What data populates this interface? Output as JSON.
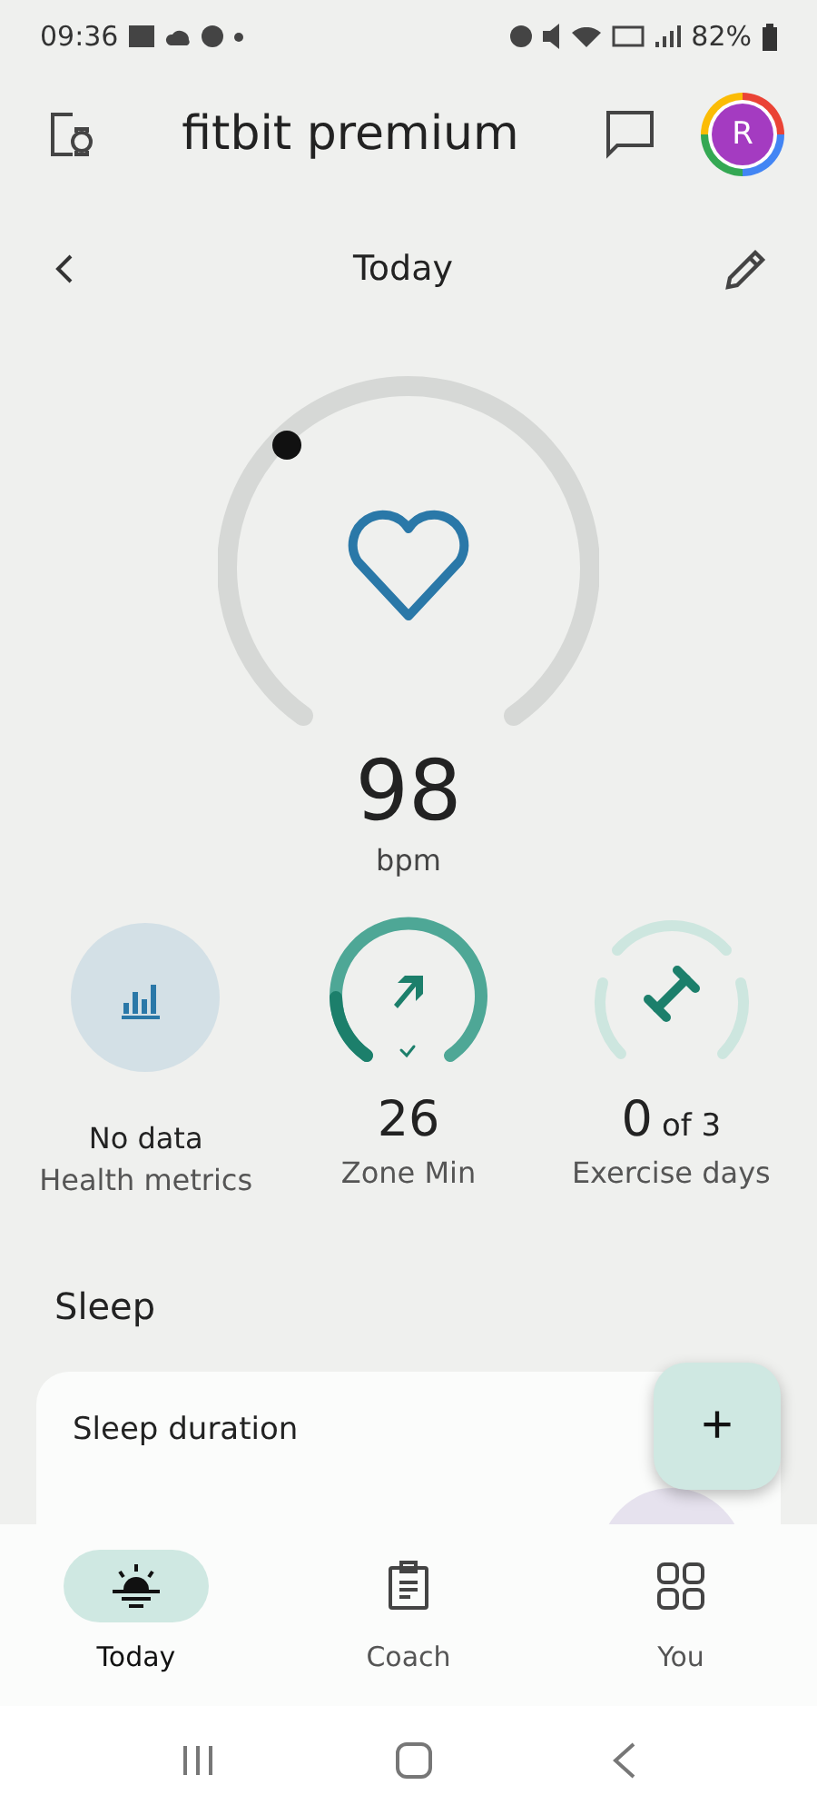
{
  "status_bar": {
    "time": "09:36",
    "battery": "82%"
  },
  "header": {
    "title": "fitbit premium",
    "avatar": "R"
  },
  "date_nav": {
    "title": "Today"
  },
  "heart": {
    "value": "98",
    "unit": "bpm"
  },
  "stats": [
    {
      "kind": "metrics",
      "value": "No data",
      "label": "Health metrics"
    },
    {
      "kind": "zone",
      "value": "26",
      "label": "Zone Min"
    },
    {
      "kind": "exercise",
      "value": "0",
      "suffix": "of 3",
      "label": "Exercise days"
    }
  ],
  "section": {
    "title": "Sleep",
    "card_title": "Sleep duration"
  },
  "fab": {
    "label": "+"
  },
  "tabs": [
    {
      "label": "Today",
      "selected": true
    },
    {
      "label": "Coach",
      "selected": false
    },
    {
      "label": "You",
      "selected": false
    }
  ]
}
